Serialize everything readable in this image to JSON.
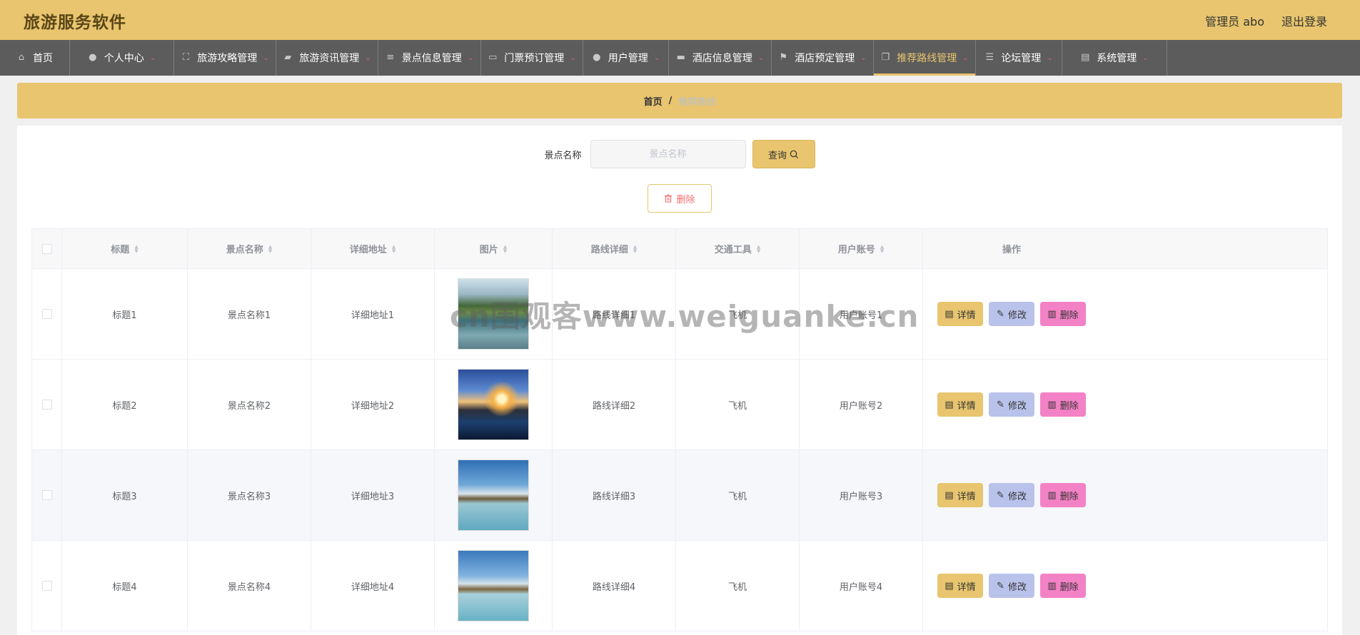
{
  "app": {
    "title": "旅游服务软件"
  },
  "header": {
    "user": "管理员 abo",
    "logout": "退出登录"
  },
  "nav": [
    {
      "label": "首页",
      "icon": "home-icon",
      "dropdown": false,
      "active": false
    },
    {
      "label": "个人中心",
      "icon": "user-icon",
      "dropdown": true,
      "active": false
    },
    {
      "label": "旅游攻略管理",
      "icon": "fullscreen-icon",
      "dropdown": true,
      "active": false
    },
    {
      "label": "旅游资讯管理",
      "icon": "briefcase-icon",
      "dropdown": true,
      "active": false
    },
    {
      "label": "景点信息管理",
      "icon": "sliders-icon",
      "dropdown": true,
      "active": false
    },
    {
      "label": "门票预订管理",
      "icon": "chat-icon",
      "dropdown": true,
      "active": false
    },
    {
      "label": "用户管理",
      "icon": "user-icon",
      "dropdown": true,
      "active": false
    },
    {
      "label": "酒店信息管理",
      "icon": "stack-icon",
      "dropdown": true,
      "active": false
    },
    {
      "label": "酒店预定管理",
      "icon": "flag-icon",
      "dropdown": true,
      "active": false
    },
    {
      "label": "推荐路线管理",
      "icon": "copy-icon",
      "dropdown": true,
      "active": true
    },
    {
      "label": "论坛管理",
      "icon": "list-icon",
      "dropdown": true,
      "active": false
    },
    {
      "label": "系统管理",
      "icon": "message-icon",
      "dropdown": true,
      "active": false
    }
  ],
  "breadcrumb": {
    "home": "首页",
    "sep": "/",
    "current": "推荐路线"
  },
  "search": {
    "label": "景点名称",
    "placeholder": "景点名称",
    "value": "",
    "button": "查询"
  },
  "actions": {
    "delete": "删除"
  },
  "table": {
    "columns": [
      "标题",
      "景点名称",
      "详细地址",
      "图片",
      "路线详细",
      "交通工具",
      "用户账号",
      "操作"
    ],
    "rows": [
      {
        "title": "标题1",
        "spot": "景点名称1",
        "address": "详细地址1",
        "image": "lake-mountain-photo",
        "route": "路线详细1",
        "transport": "飞机",
        "account": "用户账号1",
        "shaded": false
      },
      {
        "title": "标题2",
        "spot": "景点名称2",
        "address": "详细地址2",
        "image": "sunset-pier-photo",
        "route": "路线详细2",
        "transport": "飞机",
        "account": "用户账号2",
        "shaded": false
      },
      {
        "title": "标题3",
        "spot": "景点名称3",
        "address": "详细地址3",
        "image": "mountain-lake-photo",
        "route": "路线详细3",
        "transport": "飞机",
        "account": "用户账号3",
        "shaded": true
      },
      {
        "title": "标题4",
        "spot": "景点名称4",
        "address": "详细地址4",
        "image": "mountain-lake-photo",
        "route": "路线详细4",
        "transport": "飞机",
        "account": "用户账号4",
        "shaded": false
      }
    ],
    "row_actions": {
      "detail": "详情",
      "edit": "修改",
      "delete": "删除"
    }
  },
  "watermark": "cn围观客www.weiguanke.cn",
  "colors": {
    "accent": "#e8c56e",
    "nav_bg": "#5c5c5c",
    "edit": "#b9c2ea",
    "delete": "#f381c5"
  }
}
